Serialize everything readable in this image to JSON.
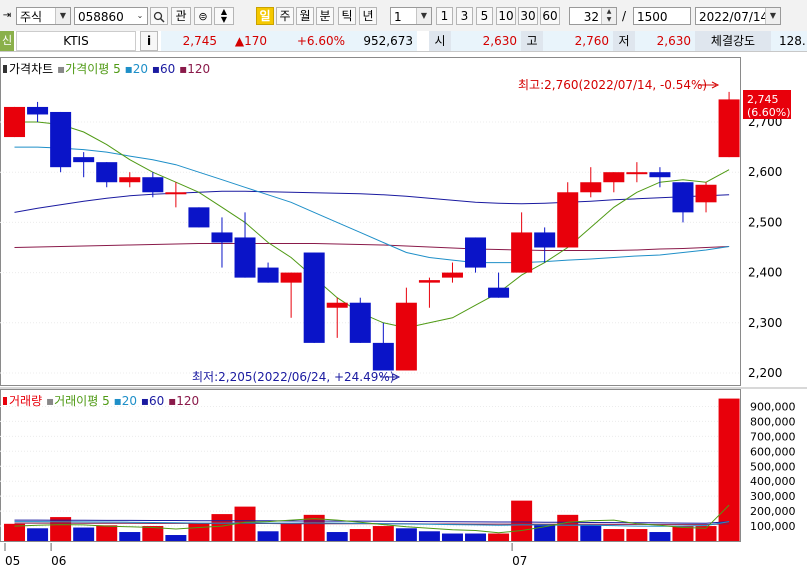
{
  "toolbar": {
    "market_select": "주식",
    "stock_code": "058860",
    "btn_gwan": "관",
    "btn_il": "일",
    "btn_ju": "주",
    "btn_wol": "월",
    "btn_bun": "분",
    "btn_tik": "틱",
    "btn_nyeon": "년",
    "period_select": "1",
    "period_buttons": [
      "1",
      "3",
      "5",
      "10",
      "30",
      "60"
    ],
    "count_value": "32",
    "slash": "/",
    "total_value": "1500",
    "date_value": "2022/07/14"
  },
  "quote": {
    "credit_label": "신",
    "stock_name": "KTIS",
    "info_btn": "i",
    "price": "2,745",
    "change": "▲170",
    "change_pct": "+6.60%",
    "volume": "952,673",
    "open_label": "시",
    "open": "2,630",
    "high_label": "고",
    "high": "2,760",
    "low_label": "저",
    "low": "2,630",
    "strength_label": "체결강도",
    "strength": "128."
  },
  "price_legend": {
    "title": "가격차트",
    "ma_title": "가격이평",
    "ma_5": "5",
    "ma_20": "20",
    "ma_60": "60",
    "ma_120": "120"
  },
  "volume_legend": {
    "title": "거래량",
    "ma_title": "거래이평",
    "ma_5": "5",
    "ma_20": "20",
    "ma_60": "60",
    "ma_120": "120"
  },
  "colors": {
    "up": "#e8000b",
    "down": "#0a14c8",
    "ma5": "#4f9a14",
    "ma20": "#1e8fc8",
    "ma60": "#1a1aa0",
    "ma120": "#8a1a4a"
  },
  "annotations": {
    "high_note": "최고:2,760(2022/07/14, -0.54%)",
    "low_note": "최저:2,205(2022/06/24, +24.49%)",
    "current_price": "2,745",
    "current_pct": "(6.60%)"
  },
  "chart_data": [
    {
      "type": "candlestick",
      "title": "가격차트",
      "ylim": [
        2180,
        2850
      ],
      "y_ticks": [
        2200,
        2300,
        2400,
        2500,
        2600,
        2700
      ],
      "y_tick_labels": [
        "2,200",
        "2,300",
        "2,400",
        "2,500",
        "2,600",
        "2,700"
      ],
      "x_tick_labels": [
        "05",
        "06",
        "07"
      ],
      "candles": [
        {
          "o": 2670,
          "h": 2730,
          "l": 2670,
          "c": 2730
        },
        {
          "o": 2730,
          "h": 2740,
          "l": 2700,
          "c": 2715
        },
        {
          "o": 2720,
          "h": 2720,
          "l": 2600,
          "c": 2610
        },
        {
          "o": 2630,
          "h": 2640,
          "l": 2590,
          "c": 2620
        },
        {
          "o": 2620,
          "h": 2620,
          "l": 2570,
          "c": 2580
        },
        {
          "o": 2580,
          "h": 2600,
          "l": 2570,
          "c": 2590
        },
        {
          "o": 2590,
          "h": 2600,
          "l": 2550,
          "c": 2560
        },
        {
          "o": 2560,
          "h": 2580,
          "l": 2530,
          "c": 2560
        },
        {
          "o": 2530,
          "h": 2530,
          "l": 2490,
          "c": 2490
        },
        {
          "o": 2480,
          "h": 2510,
          "l": 2410,
          "c": 2460
        },
        {
          "o": 2470,
          "h": 2520,
          "l": 2390,
          "c": 2390
        },
        {
          "o": 2410,
          "h": 2420,
          "l": 2380,
          "c": 2380
        },
        {
          "o": 2380,
          "h": 2400,
          "l": 2310,
          "c": 2400
        },
        {
          "o": 2440,
          "h": 2440,
          "l": 2260,
          "c": 2260
        },
        {
          "o": 2330,
          "h": 2350,
          "l": 2270,
          "c": 2340
        },
        {
          "o": 2340,
          "h": 2350,
          "l": 2260,
          "c": 2260
        },
        {
          "o": 2260,
          "h": 2300,
          "l": 2205,
          "c": 2205
        },
        {
          "o": 2205,
          "h": 2370,
          "l": 2205,
          "c": 2340
        },
        {
          "o": 2380,
          "h": 2390,
          "l": 2330,
          "c": 2385
        },
        {
          "o": 2390,
          "h": 2420,
          "l": 2380,
          "c": 2400
        },
        {
          "o": 2470,
          "h": 2470,
          "l": 2400,
          "c": 2410
        },
        {
          "o": 2370,
          "h": 2400,
          "l": 2350,
          "c": 2350
        },
        {
          "o": 2400,
          "h": 2520,
          "l": 2400,
          "c": 2480
        },
        {
          "o": 2480,
          "h": 2490,
          "l": 2420,
          "c": 2450
        },
        {
          "o": 2450,
          "h": 2580,
          "l": 2450,
          "c": 2560
        },
        {
          "o": 2560,
          "h": 2610,
          "l": 2550,
          "c": 2580
        },
        {
          "o": 2580,
          "h": 2600,
          "l": 2560,
          "c": 2600
        },
        {
          "o": 2600,
          "h": 2620,
          "l": 2580,
          "c": 2600
        },
        {
          "o": 2600,
          "h": 2610,
          "l": 2570,
          "c": 2590
        },
        {
          "o": 2580,
          "h": 2580,
          "l": 2500,
          "c": 2520
        },
        {
          "o": 2540,
          "h": 2580,
          "l": 2520,
          "c": 2575
        },
        {
          "o": 2630,
          "h": 2760,
          "l": 2630,
          "c": 2745
        }
      ],
      "ma5": [
        2700,
        2700,
        2695,
        2680,
        2655,
        2625,
        2600,
        2580,
        2560,
        2530,
        2500,
        2460,
        2430,
        2390,
        2350,
        2320,
        2300,
        2290,
        2300,
        2310,
        2335,
        2360,
        2395,
        2420,
        2450,
        2490,
        2530,
        2560,
        2580,
        2585,
        2580,
        2605
      ],
      "ma20": [
        2650,
        2650,
        2648,
        2645,
        2640,
        2632,
        2625,
        2615,
        2600,
        2585,
        2570,
        2555,
        2540,
        2520,
        2500,
        2480,
        2460,
        2440,
        2430,
        2425,
        2420,
        2420,
        2420,
        2422,
        2425,
        2427,
        2430,
        2433,
        2435,
        2440,
        2445,
        2452
      ],
      "ma60": [
        2520,
        2528,
        2535,
        2542,
        2548,
        2553,
        2556,
        2558,
        2560,
        2562,
        2562,
        2561,
        2560,
        2559,
        2558,
        2557,
        2555,
        2552,
        2548,
        2544,
        2540,
        2538,
        2537,
        2538,
        2540,
        2542,
        2545,
        2547,
        2549,
        2551,
        2553,
        2555
      ],
      "ma120": [
        2450,
        2451,
        2452,
        2453,
        2454,
        2455,
        2456,
        2457,
        2458,
        2458,
        2458,
        2458,
        2458,
        2458,
        2457,
        2456,
        2455,
        2453,
        2451,
        2449,
        2447,
        2446,
        2445,
        2444,
        2444,
        2444,
        2444,
        2445,
        2447,
        2448,
        2450,
        2452
      ],
      "high_value": 2760,
      "low_value": 2205
    },
    {
      "type": "bar",
      "title": "거래량",
      "ylim": [
        0,
        1000000
      ],
      "y_ticks": [
        100000,
        200000,
        300000,
        400000,
        500000,
        600000,
        700000,
        800000,
        900000
      ],
      "y_tick_labels": [
        "100,000",
        "200,000",
        "300,000",
        "400,000",
        "500,000",
        "600,000",
        "700,000",
        "800,000",
        "900,000"
      ],
      "values": [
        115000,
        85000,
        160000,
        90000,
        105000,
        60000,
        100000,
        40000,
        120000,
        180000,
        230000,
        65000,
        120000,
        175000,
        60000,
        80000,
        100000,
        85000,
        65000,
        50000,
        50000,
        50000,
        270000,
        110000,
        175000,
        105000,
        80000,
        80000,
        60000,
        100000,
        100000,
        952673
      ],
      "up": [
        true,
        false,
        true,
        false,
        true,
        false,
        true,
        false,
        true,
        true,
        true,
        false,
        true,
        true,
        false,
        true,
        true,
        false,
        false,
        false,
        false,
        true,
        true,
        false,
        true,
        false,
        true,
        true,
        false,
        true,
        true,
        true
      ],
      "ma5": [
        100000,
        105000,
        110000,
        108000,
        100000,
        95000,
        90000,
        80000,
        90000,
        100000,
        125000,
        130000,
        140000,
        150000,
        140000,
        125000,
        110000,
        95000,
        85000,
        75000,
        70000,
        55000,
        70000,
        95000,
        125000,
        135000,
        140000,
        115000,
        105000,
        90000,
        85000,
        240000
      ],
      "ma20": [
        130000,
        130000,
        129000,
        128000,
        127000,
        126000,
        124000,
        122000,
        120000,
        120000,
        121000,
        120000,
        120000,
        121000,
        120000,
        118000,
        116000,
        114000,
        112000,
        110000,
        108000,
        106000,
        108000,
        107000,
        106000,
        105000,
        103000,
        100000,
        98000,
        100000,
        104000,
        130000
      ],
      "ma60": [
        140000,
        140000,
        139000,
        139000,
        138000,
        138000,
        137000,
        137000,
        136000,
        136000,
        135000,
        135000,
        134000,
        134000,
        133000,
        133000,
        132000,
        131000,
        130000,
        129000,
        128000,
        127000,
        127000,
        126000,
        125000,
        124000,
        123000,
        122000,
        121000,
        120000,
        119000,
        130000
      ],
      "ma120": [
        120000,
        120000,
        120000,
        119000,
        119000,
        119000,
        118000,
        118000,
        118000,
        117000,
        117000,
        117000,
        116000,
        116000,
        116000,
        115000,
        115000,
        115000,
        114000,
        114000,
        113000,
        113000,
        113000,
        112000,
        112000,
        112000,
        111000,
        111000,
        110000,
        110000,
        110000,
        115000
      ]
    }
  ]
}
